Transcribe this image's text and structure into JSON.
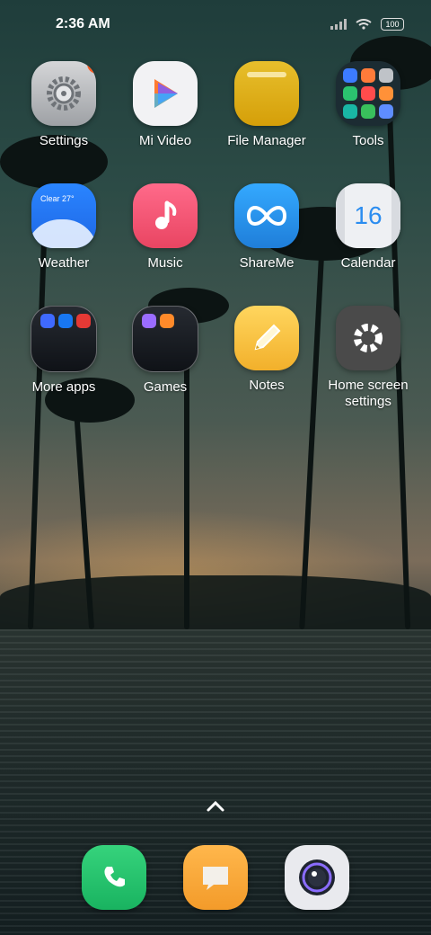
{
  "status": {
    "time": "2:36 AM",
    "battery": "100"
  },
  "apps": [
    {
      "label": "Settings",
      "icon": "settings-gear-icon",
      "badge": "1"
    },
    {
      "label": "Mi Video",
      "icon": "play-triangle-icon"
    },
    {
      "label": "File Manager",
      "icon": "folder-icon"
    },
    {
      "label": "Tools",
      "icon": "tools-grid-icon"
    },
    {
      "label": "Weather",
      "icon": "cloud-icon",
      "icon_text": "Clear 27°"
    },
    {
      "label": "Music",
      "icon": "music-note-icon"
    },
    {
      "label": "ShareMe",
      "icon": "infinity-icon"
    },
    {
      "label": "Calendar",
      "icon": "calendar-icon",
      "icon_text": "16"
    },
    {
      "label": "More apps",
      "icon": "folder-icon"
    },
    {
      "label": "Games",
      "icon": "folder-icon"
    },
    {
      "label": "Notes",
      "icon": "pencil-icon"
    },
    {
      "label": "Home screen settings",
      "icon": "gear-icon"
    }
  ],
  "dock": [
    {
      "name": "Phone",
      "icon": "phone-icon"
    },
    {
      "name": "Messaging",
      "icon": "message-icon"
    },
    {
      "name": "Camera",
      "icon": "camera-lens-icon"
    }
  ],
  "colors": {
    "badge": "#ff5a1f",
    "accent_blue": "#1e66e5"
  }
}
